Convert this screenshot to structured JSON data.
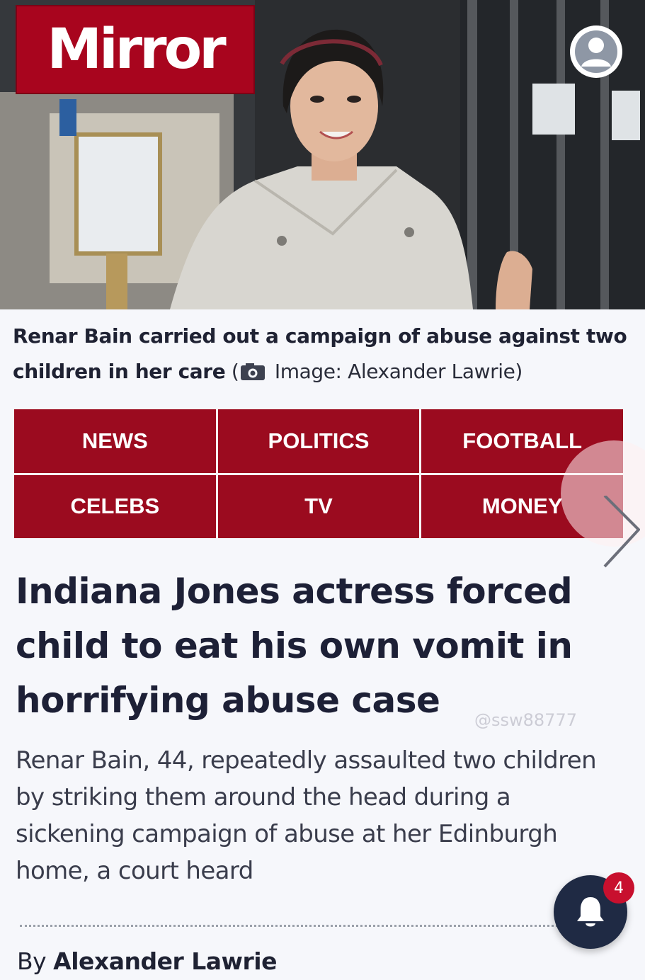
{
  "brand": {
    "logo_text": "Mirror",
    "color": "#a8051e"
  },
  "header": {
    "account_icon": "user-circle-icon"
  },
  "caption": {
    "text": "Renar Bain carried out a campaign of abuse against two children in her care",
    "open_paren": " (",
    "camera_icon": "camera-icon",
    "credit": " Image: Alexander Lawrie)"
  },
  "nav": {
    "color": "#9b0b1f",
    "items": [
      {
        "label": "NEWS"
      },
      {
        "label": "POLITICS"
      },
      {
        "label": "FOOTBALL"
      },
      {
        "label": "CELEBS"
      },
      {
        "label": "TV"
      },
      {
        "label": "MONEY"
      }
    ],
    "next_icon": "chevron-right-icon"
  },
  "article": {
    "headline": "Indiana Jones actress forced child to eat his own vomit in horrifying abuse case",
    "standfirst": "Renar Bain, 44, repeatedly assaulted two children by striking them around the head during a sickening campaign of abuse at her Edinburgh home, a court heard",
    "byline_prefix": "By ",
    "author": "Alexander Lawrie"
  },
  "watermark": {
    "text": "@ssw88777"
  },
  "notifications": {
    "icon": "bell-icon",
    "count": "4"
  }
}
